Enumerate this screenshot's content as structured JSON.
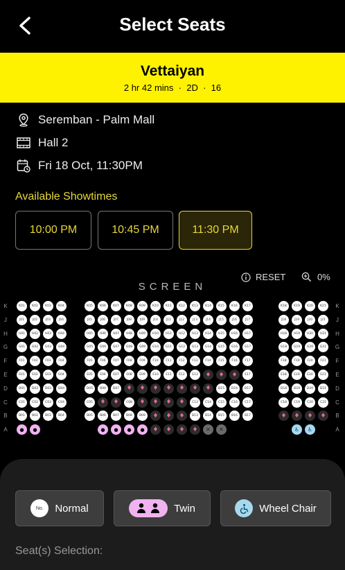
{
  "header": {
    "title": "Select Seats"
  },
  "movie": {
    "name": "Vettaiyan",
    "duration": "2 hr 42 mins",
    "format": "2D",
    "rating": "16",
    "separator": "·"
  },
  "details": {
    "location": "Seremban - Palm Mall",
    "hall": "Hall 2",
    "datetime": "Fri 18 Oct, 11:30PM"
  },
  "showtimes": {
    "label": "Available Showtimes",
    "items": [
      "10:00 PM",
      "10:45 PM",
      "11:30 PM"
    ],
    "selected": "11:30 PM"
  },
  "seatmap": {
    "reset_label": "RESET",
    "zoom": "0%",
    "screen_label": "SCREEN",
    "rows": [
      "K",
      "J",
      "H",
      "G",
      "F",
      "E",
      "D",
      "C",
      "B",
      "A"
    ],
    "blocks": {
      "left": [
        1,
        2,
        3,
        4
      ],
      "middle": [
        5,
        6,
        7,
        8,
        9,
        10,
        11,
        12,
        13,
        14,
        15,
        16,
        17
      ],
      "right": [
        18,
        19,
        20,
        21
      ]
    },
    "occupied": [
      "E14",
      "E15",
      "E16",
      "D8",
      "D9",
      "D10",
      "D11",
      "D12",
      "D13",
      "D14",
      "C6",
      "C7",
      "C9",
      "C10",
      "C11",
      "C12",
      "B10",
      "B11",
      "B12",
      "B18",
      "B19",
      "B20",
      "B21"
    ],
    "row_a": [
      {
        "type": "twin",
        "col": 1
      },
      {
        "type": "twin",
        "col": 2
      },
      {
        "type": "twin",
        "col": 6
      },
      {
        "type": "twin",
        "col": 7
      },
      {
        "type": "twin",
        "col": 8
      },
      {
        "type": "twin",
        "col": 9
      },
      {
        "type": "occ",
        "col": 10
      },
      {
        "type": "occ",
        "col": 11
      },
      {
        "type": "occ",
        "col": 12
      },
      {
        "type": "occ",
        "col": 13
      },
      {
        "type": "dark",
        "col": 14
      },
      {
        "type": "dark",
        "col": 15
      },
      {
        "type": "wc",
        "col": 19
      },
      {
        "type": "wc",
        "col": 20
      }
    ]
  },
  "legend": {
    "normal_badge": "No.",
    "normal": "Normal",
    "twin": "Twin",
    "wheelchair": "Wheel Chair"
  },
  "selection_label": "Seat(s) Selection:",
  "colors": {
    "accent": "#fff200",
    "gold_text": "#e6d83a",
    "twin": "#f0b3f0",
    "wheelchair": "#a7d8ee",
    "occupied_mark": "#e06a95"
  }
}
